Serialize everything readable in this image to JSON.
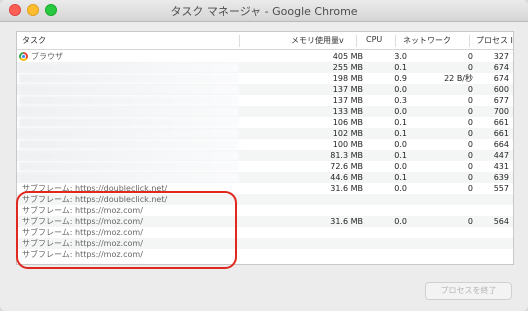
{
  "window": {
    "title": "タスク マネージャ - Google Chrome"
  },
  "columns": {
    "task": "タスク",
    "memory": "メモリ使用量",
    "sort_arrow": "v",
    "cpu": "CPU",
    "network": "ネットワーク",
    "pid": "プロセス ID"
  },
  "rows": [
    {
      "task": "ブラウザ",
      "icon": "chrome-icon",
      "memory": "405 MB",
      "cpu": "3.0",
      "network": "0",
      "pid": "327"
    },
    {
      "task": "",
      "memory": "255 MB",
      "cpu": "0.1",
      "network": "0",
      "pid": "674"
    },
    {
      "task": "",
      "memory": "198 MB",
      "cpu": "0.9",
      "network": "22 B/秒",
      "pid": "674"
    },
    {
      "task": "",
      "memory": "137 MB",
      "cpu": "0.0",
      "network": "0",
      "pid": "600"
    },
    {
      "task": "",
      "memory": "137 MB",
      "cpu": "0.3",
      "network": "0",
      "pid": "677"
    },
    {
      "task": "",
      "memory": "133 MB",
      "cpu": "0.0",
      "network": "0",
      "pid": "700"
    },
    {
      "task": "",
      "memory": "106 MB",
      "cpu": "0.1",
      "network": "0",
      "pid": "661"
    },
    {
      "task": "",
      "memory": "102 MB",
      "cpu": "0.1",
      "network": "0",
      "pid": "661"
    },
    {
      "task": "",
      "memory": "100 MB",
      "cpu": "0.0",
      "network": "0",
      "pid": "664"
    },
    {
      "task": "",
      "memory": "81.3 MB",
      "cpu": "0.1",
      "network": "0",
      "pid": "447"
    },
    {
      "task": "",
      "memory": "72.6 MB",
      "cpu": "0.0",
      "network": "0",
      "pid": "431"
    },
    {
      "task": "",
      "memory": "44.6 MB",
      "cpu": "0.1",
      "network": "0",
      "pid": "639"
    },
    {
      "task": "サブフレーム: https://doubleclick.net/",
      "memory": "31.6 MB",
      "cpu": "0.0",
      "network": "0",
      "pid": "557"
    },
    {
      "task": "サブフレーム: https://doubleclick.net/",
      "memory": "",
      "cpu": "",
      "network": "",
      "pid": ""
    },
    {
      "task": "サブフレーム: https://moz.com/",
      "memory": "",
      "cpu": "",
      "network": "",
      "pid": ""
    },
    {
      "task": "サブフレーム: https://moz.com/",
      "memory": "31.6 MB",
      "cpu": "0.0",
      "network": "0",
      "pid": "564"
    },
    {
      "task": "サブフレーム: https://moz.com/",
      "memory": "",
      "cpu": "",
      "network": "",
      "pid": ""
    },
    {
      "task": "サブフレーム: https://moz.com/",
      "memory": "",
      "cpu": "",
      "network": "",
      "pid": ""
    },
    {
      "task": "サブフレーム: https://moz.com/",
      "memory": "",
      "cpu": "",
      "network": "",
      "pid": ""
    }
  ],
  "buttons": {
    "end_process": "プロセスを終了"
  },
  "highlight_color": "#e0281f"
}
